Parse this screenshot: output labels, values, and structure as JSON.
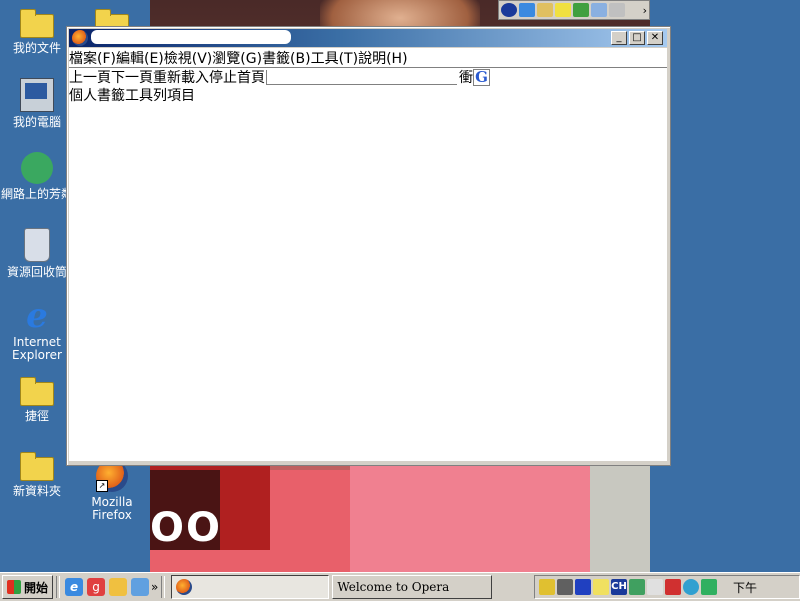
{
  "desktop": {
    "icons": [
      {
        "label": "我的文件"
      },
      {
        "label": "我的電腦"
      },
      {
        "label": "網路上的芳鄰"
      },
      {
        "label": "資源回收筒"
      },
      {
        "label": "Internet Explorer"
      },
      {
        "label": "捷徑"
      },
      {
        "label": "新資料夾"
      },
      {
        "label": "Mozilla Firefox"
      }
    ]
  },
  "wallpaper": {
    "overlay_text": "OO"
  },
  "window": {
    "title": "",
    "buttons": {
      "minimize": "_",
      "maximize": "□",
      "close": "✕"
    },
    "menu": [
      "檔案(F)",
      "編輯(E)",
      "檢視(V)",
      "瀏覽(G)",
      "書籤(B)",
      "工具(T)",
      "說明(H)"
    ],
    "nav": {
      "back": "上一頁",
      "forward": "下一頁",
      "reload": "重新載入",
      "stop": "停止",
      "home": "首頁",
      "url_value": "",
      "go": "衝",
      "search_engine_icon": "G"
    },
    "bookmarks": {
      "label": "個人書籤工具列項目"
    }
  },
  "taskbar": {
    "start": "開始",
    "quick_launch_more": "»",
    "tasks": [
      {
        "label": "",
        "icon": "firefox-icon",
        "active": true
      },
      {
        "label": "Welcome to Opera",
        "active": false
      }
    ],
    "tray_input": "CH",
    "clock": "下午"
  },
  "colors": {
    "desktop": "#3a6ea5",
    "chrome": "#d4d0c8",
    "titlebar_start": "#0a246a",
    "titlebar_end": "#a6caf0"
  }
}
